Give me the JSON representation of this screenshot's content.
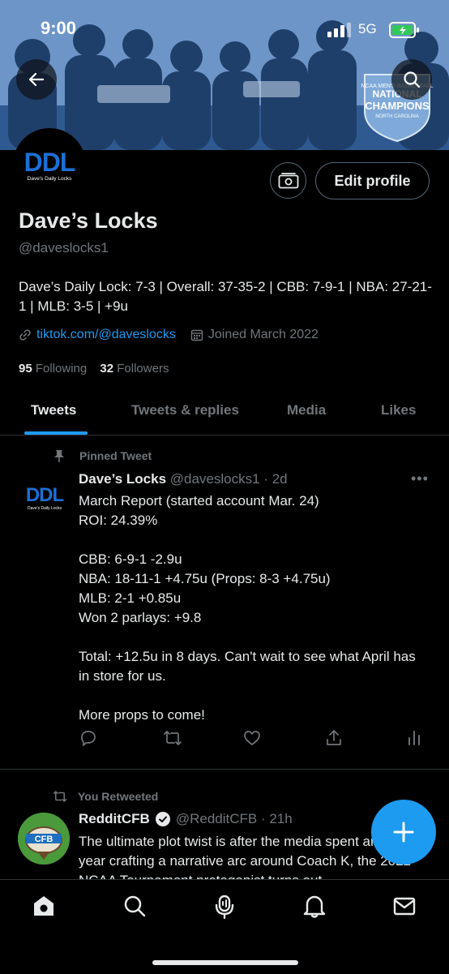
{
  "status": {
    "time": "9:00",
    "network": "5G"
  },
  "profile": {
    "name": "Dave’s Locks",
    "handle": "@daveslocks1",
    "avatar_text": "DDL",
    "avatar_subtext": "Dave's Daily Locks",
    "edit_label": "Edit profile",
    "bio": "Dave’s Daily Lock: 7-3 | Overall: 37-35-2 | CBB: 7-9-1 | NBA: 27-21-1 | MLB: 3-5 | +9u",
    "link": "tiktok.com/@daveslocks",
    "joined": "Joined March 2022",
    "following_count": "95",
    "following_label": "Following",
    "followers_count": "32",
    "followers_label": "Followers"
  },
  "tabs": [
    "Tweets",
    "Tweets & replies",
    "Media",
    "Likes"
  ],
  "pinned_tweet": {
    "context": "Pinned Tweet",
    "author": "Dave’s Locks",
    "meta": "@daveslocks1 · 2d",
    "lines": [
      "March Report (started account Mar. 24)",
      "ROI: 24.39%",
      "",
      "CBB: 6-9-1 -2.9u",
      "NBA: 18-11-1 +4.75u (Props: 8-3 +4.75u)",
      "MLB: 2-1 +0.85u",
      "Won 2 parlays: +9.8",
      "",
      "Total: +12.5u in 8 days. Can't wait to see what April has in store for us.",
      "",
      "More props to come!"
    ]
  },
  "retweet": {
    "context": "You Retweeted",
    "author": "RedditCFB",
    "meta": "@RedditCFB · 21h",
    "avatar_text": "CFB",
    "text": "The ultimate plot twist is after the media spent an entire year crafting a narrative arc around Coach K, the 2022 NCAA Tournament protagonist turns out"
  },
  "banner": {
    "badge_top": "NCAA MEN'S BASKETBALL",
    "badge_main": "CHAMPIONS",
    "badge_sub": "NORTH CAROLINA",
    "badge_arc": "NATIONAL"
  },
  "colors": {
    "accent": "#1d9bf0",
    "ddl_blue": "#1d6fd6",
    "muted": "#71767b"
  }
}
